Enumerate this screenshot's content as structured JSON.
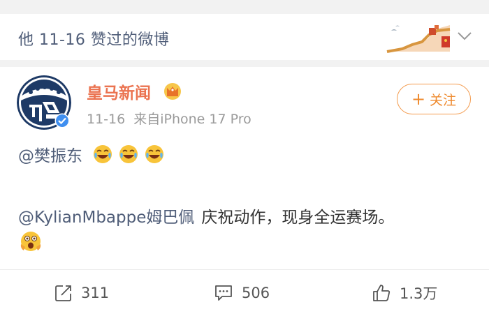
{
  "section": {
    "title": "他 11-16 赞过的微博"
  },
  "post": {
    "author": "皇马新闻",
    "time": "11-16",
    "source": "来自iPhone 17 Pro",
    "follow_label": "关注",
    "mention1": "@樊振东",
    "mention2": "@KylianMbappe姆巴佩",
    "text2": "庆祝动作，现身全运赛场。",
    "emojis_line1": [
      "laugh-cry-emoji",
      "laugh-cry-emoji",
      "laugh-cry-emoji"
    ],
    "emoji_line3": "shocked-emoji"
  },
  "actions": {
    "repost_count": "311",
    "comment_count": "506",
    "like_count": "1.3万"
  },
  "colors": {
    "accent_orange": "#eb7350",
    "link_blue": "#4f5d78",
    "follow_orange": "#ef8a2e"
  }
}
